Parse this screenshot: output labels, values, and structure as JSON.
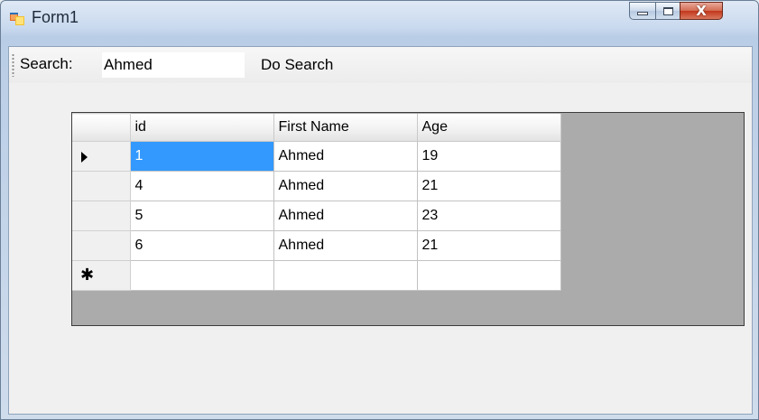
{
  "window": {
    "title": "Form1",
    "close_glyph": "X",
    "colors": {
      "selection": "#3399ff",
      "grid_background": "#ababab"
    }
  },
  "toolbar": {
    "search_label": "Search:",
    "search_value": "Ahmed",
    "search_button_label": "Do Search"
  },
  "grid": {
    "columns": [
      "id",
      "First Name",
      "Age"
    ],
    "rows": [
      {
        "id": "1",
        "first_name": "Ahmed",
        "age": "19",
        "current": true
      },
      {
        "id": "4",
        "first_name": "Ahmed",
        "age": "21"
      },
      {
        "id": "5",
        "first_name": "Ahmed",
        "age": "23"
      },
      {
        "id": "6",
        "first_name": "Ahmed",
        "age": "21"
      }
    ],
    "current_row_marker": "arrow-right-icon",
    "new_row_marker": "✱"
  }
}
